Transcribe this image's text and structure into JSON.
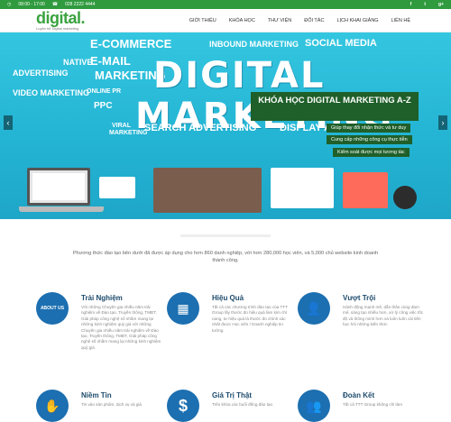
{
  "topbar": {
    "hours": "08:00 - 17:00",
    "phone": "028 2222 4444",
    "social": [
      "f",
      "t",
      "g+"
    ]
  },
  "logo": {
    "text": "digital.",
    "tagline": "Luyện hệ Digital marketing"
  },
  "nav": [
    "GIỚI THIỆU",
    "KHÓA HỌC",
    "THƯ VIỆN",
    "ĐỐI TÁC",
    "LỊCH KHAI GIẢNG",
    "LIÊN HỆ"
  ],
  "hero": {
    "words": [
      "E-COMMERCE",
      "INBOUND MARKETING",
      "SOCIAL MEDIA",
      "NATIVE",
      "ADVERTISING",
      "E-MAIL",
      "MARKETING",
      "VIDEO MARKETING",
      "ONLINE PR",
      "PPC",
      "DIGITAL",
      "MARKETING",
      "VIRAL",
      "MARKETING",
      "SEARCH ADVERTISING",
      "DISPLAY ADVERTISING"
    ],
    "promo_title": "KHÓA HỌC DIGITAL MARKETING A-Z",
    "promo_items": [
      "Giúp thay đổi nhận thức và tư duy",
      "Cung cấp những công cụ thực tiễn",
      "Kiểm soát được mọi tương tác"
    ],
    "prev": "‹",
    "next": "›"
  },
  "intro": "Phương thức đào tạo bên dưới đã được áp dụng cho hơn 860 danh nghiệp, với hơn 280,000 học viên, và 5,000 chủ website kinh doanh thành công.",
  "features": [
    {
      "title": "Trải Nghiệm",
      "icon": "ABOUT US",
      "color": "#1c6fb0",
      "text": "Với những Chuyên gia nhiều năm trải nghiệm về Đào tạo, Truyền thông, TMĐT, Giải pháp công nghệ sổ nhằm mang lại những kinh nghiệm quý giá với những Chuyên gia nhiều năm trải nghiệm về Đào tạo, Truyền thông, TMĐT, Giải pháp công nghệ số nhằm mang lại những kinh nghiệm quý giá"
    },
    {
      "title": "Hiệu Quả",
      "icon": "▦",
      "color": "#1c6fb0",
      "text": "Tất cả các chương trình đào tạo của TTT Group lấy thước đo hiệu quả làm kim chỉ nang, tư hiệu quả là thước đo chính xác nhất được Học viên / Doanh nghiệp tin tưởng"
    },
    {
      "title": "Vượt Trội",
      "icon": "👤",
      "color": "#1c6fb0",
      "text": "Hành động mạnh mẽ, dẫn thân cùng đam mê, sáng tạo nhiều hơn, xử lý công việc tốc độ và thông minh hơn và luôn luôn cải tiến học hỏi những kiến thức"
    },
    {
      "title": "Niềm Tin",
      "icon": "✋",
      "color": "#1c6fb0",
      "text": "Tin vào sản phẩm, dịch vụ và giá"
    },
    {
      "title": "Giá Trị Thật",
      "icon": "$",
      "color": "#1c6fb0",
      "text": "Trên khóa các buổi đồng đào tạo"
    },
    {
      "title": "Đoàn Kết",
      "icon": "👥",
      "color": "#1c6fb0",
      "text": "Tất cả TTT Group không chỉ làm"
    }
  ]
}
